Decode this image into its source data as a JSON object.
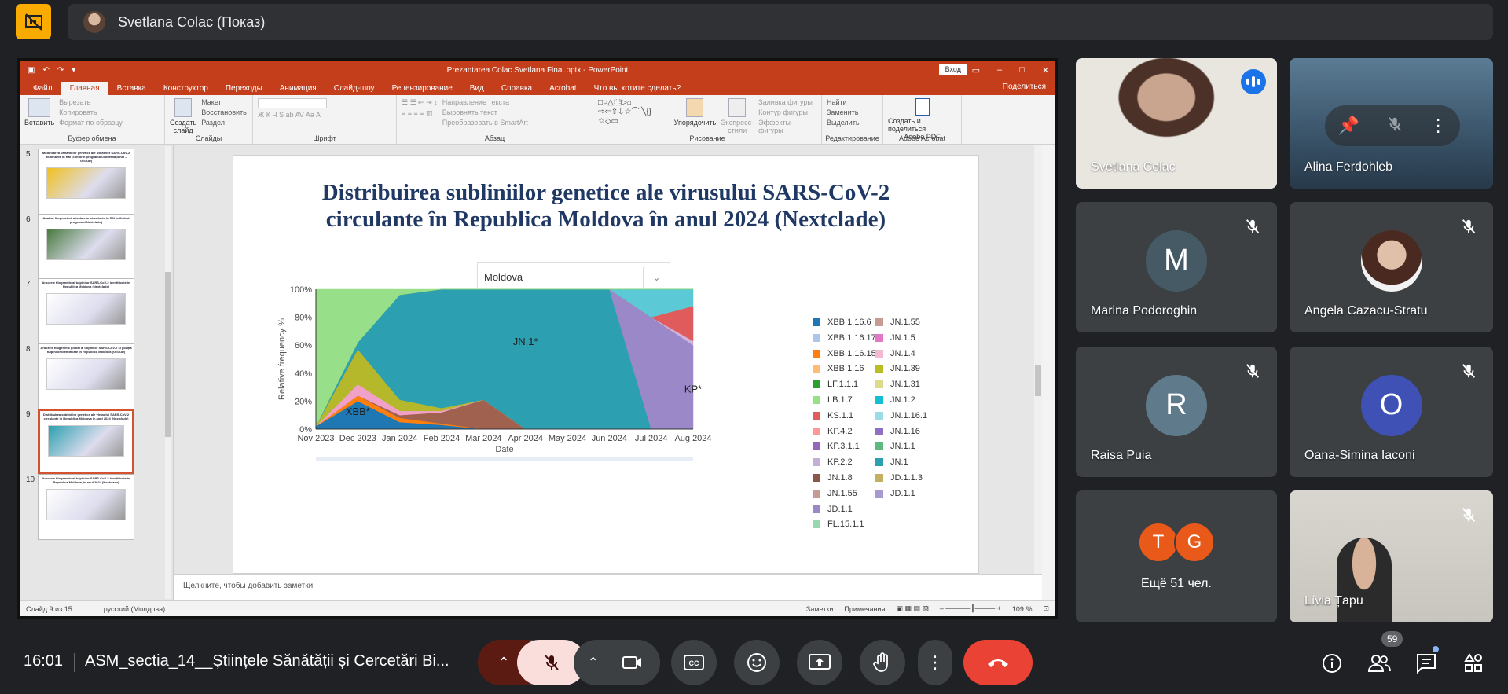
{
  "meet": {
    "presenter_label": "Svetlana Colac (Показ)",
    "clock": "16:01",
    "meeting_name": "ASM_sectia_14__Științele Sănătății și Cercetări Bi...",
    "participant_badge": "59",
    "colors": {
      "accent": "#8ab4f8",
      "end_call": "#ea4335",
      "mic_off": "#f9dedc",
      "logo": "#f9ab00"
    }
  },
  "participants": [
    {
      "name": "Svetlana Colac",
      "video": true,
      "speaking": true
    },
    {
      "name": "Alina Ferdohleb",
      "video": true,
      "muted": true
    },
    {
      "name": "Marina Podoroghin",
      "initial": "M",
      "color": "#455a64",
      "muted": true
    },
    {
      "name": "Angela Cazacu-Stratu",
      "photo": true,
      "muted": true
    },
    {
      "name": "Raisa Puia",
      "initial": "R",
      "color": "#5f7a8a",
      "muted": true
    },
    {
      "name": "Oana-Simina Iaconi",
      "initial": "O",
      "color": "#3f51b5",
      "muted": true
    },
    {
      "name": "Lívia Țapu",
      "video": true,
      "muted": true
    }
  ],
  "more_people": {
    "initials": [
      "T",
      "G"
    ],
    "label": "Ещё 51 чел."
  },
  "powerpoint": {
    "filename": "Prezantarea Colac Svetlana Final.pptx - PowerPoint",
    "login": "Вход",
    "share": "Поделиться",
    "tabs": [
      "Файл",
      "Главная",
      "Вставка",
      "Конструктор",
      "Переходы",
      "Анимация",
      "Слайд-шоу",
      "Рецензирование",
      "Вид",
      "Справка",
      "Acrobat",
      "Что вы хотите сделать?"
    ],
    "ribbon": {
      "paste": "Вставить",
      "cut": "Вырезать",
      "copy": "Копировать",
      "format_painter": "Формат по образцу",
      "clipboard": "Буфер обмена",
      "new_slide_1": "Создать",
      "new_slide_2": "слайд",
      "layout": "Макет",
      "reset": "Восстановить",
      "section": "Раздел",
      "slides": "Слайды",
      "font": "Шрифт",
      "text_direction": "Направление текста",
      "align_text": "Выровнять текст",
      "smartart": "Преобразовать в SmartArt",
      "paragraph": "Абзац",
      "arrange": "Упорядочить",
      "quick_styles_1": "Экспресс-",
      "quick_styles_2": "стили",
      "shape_fill": "Заливка фигуры",
      "shape_outline": "Контур фигуры",
      "shape_effects": "Эффекты фигуры",
      "drawing": "Рисование",
      "find": "Найти",
      "replace": "Заменить",
      "select": "Выделить",
      "editing": "Редактирование",
      "adobe_1": "Создать и поделиться",
      "adobe_2": "Adobe PDF",
      "adobe_acrobat": "Adobe Acrobat"
    },
    "thumbnails": [
      {
        "num": "5",
        "title": "Modificarea variantelor genetice ale izolatelor SARS-CoV-2 dominante în RM (conform programului internațional – GISAID)"
      },
      {
        "num": "6",
        "title": "Analiza filogenetică a izolatelor circulante în RM (utilizând programul Nextclade)"
      },
      {
        "num": "7",
        "title": "Arborele filogenetic al tulpinilor SARS-CoV-2 identificate în Republica Moldova (Nextclade)"
      },
      {
        "num": "8",
        "title": "Arborele filogenetic global al tulpinilor SARS-CoV-2 și poziția tulpinilor identificate în Republica Moldova (GISAID)"
      },
      {
        "num": "9",
        "title": "Distribuirea subliniilor genetice ale virusului SARS-CoV-2 circulante în Republica Moldova în anul 2024 (Nextclade)"
      },
      {
        "num": "10",
        "title": "Arborele filogenetic al tulpinilor SARS-CoV-2 identificate în Republica Moldova, în anul 2024 (Nextclade)"
      }
    ],
    "slide": {
      "title_line1": "Distribuirea subliniilor genetice ale virusului SARS-CoV-2",
      "title_line2": "circulante în Republica Moldova în anul 2024 (Nextclade)",
      "country": "Moldova"
    },
    "notes_placeholder": "Щелкните, чтобы добавить заметки",
    "status": {
      "slide": "Слайд 9 из 15",
      "language": "русский (Молдова)",
      "notes": "Заметки",
      "comments": "Примечания",
      "zoom": "109 %"
    }
  },
  "chart_data": {
    "type": "area",
    "stacked": true,
    "ylabel": "Relative frequency %",
    "xlabel": "Date",
    "x": [
      "Nov 2023",
      "Dec 2023",
      "Jan 2024",
      "Feb 2024",
      "Mar 2024",
      "Apr 2024",
      "May 2024",
      "Jun 2024",
      "Jul 2024",
      "Aug 2024"
    ],
    "yticks": [
      "0%",
      "20%",
      "40%",
      "60%",
      "80%",
      "100%"
    ],
    "ylim": [
      0,
      100
    ],
    "annotations": [
      {
        "text": "JN.1*",
        "x": "Apr 2024",
        "y": 60
      },
      {
        "text": "XBB*",
        "x": "Dec 2023",
        "y": 10
      },
      {
        "text": "KP*",
        "x": "Aug 2024",
        "y": 26
      }
    ],
    "series": [
      {
        "name": "XBB.1.16.6",
        "color": "#1f77b4",
        "values": [
          2,
          20,
          5,
          3,
          0,
          0,
          0,
          0,
          0,
          0
        ]
      },
      {
        "name": "XBB.1.16.15",
        "color": "#ff7f0e",
        "values": [
          0,
          4,
          3,
          1,
          0,
          0,
          0,
          0,
          0,
          0
        ]
      },
      {
        "name": "JN.1.55",
        "color": "#a0624e",
        "values": [
          0,
          0,
          2,
          8,
          21,
          0,
          0,
          0,
          0,
          0
        ]
      },
      {
        "name": "JN.1.4",
        "color": "#f1a1c7",
        "values": [
          0,
          8,
          3,
          1,
          0,
          0,
          0,
          0,
          0,
          0
        ]
      },
      {
        "name": "JN.1.39",
        "color": "#b5b82a",
        "values": [
          0,
          25,
          8,
          2,
          0,
          0,
          0,
          0,
          0,
          0
        ]
      },
      {
        "name": "JN.1",
        "color": "#2ca0b0",
        "values": [
          0,
          5,
          75,
          85,
          79,
          100,
          100,
          100,
          0,
          0
        ]
      },
      {
        "name": "JD.1.1",
        "color": "#9b88c9",
        "values": [
          0,
          0,
          0,
          0,
          0,
          0,
          0,
          0,
          80,
          60
        ]
      },
      {
        "name": "KP.2.2",
        "color": "#d0b3dc",
        "values": [
          0,
          0,
          0,
          0,
          0,
          0,
          0,
          0,
          0,
          3
        ]
      },
      {
        "name": "KS.1.1",
        "color": "#e05c5c",
        "values": [
          0,
          0,
          0,
          0,
          0,
          0,
          0,
          0,
          0,
          25
        ]
      },
      {
        "name": "JN.1.2",
        "color": "#5bc9d6",
        "values": [
          0,
          0,
          0,
          0,
          0,
          0,
          0,
          0,
          20,
          12
        ]
      },
      {
        "name": "LF.1.1.1",
        "color": "#2ca02c",
        "values": [
          0,
          0,
          0,
          0,
          0,
          0,
          0,
          0,
          0,
          0
        ]
      },
      {
        "name": "FL.15.1.1",
        "color": "#98df8a",
        "values": [
          98,
          38,
          4,
          0,
          0,
          0,
          0,
          0,
          0,
          0
        ]
      }
    ],
    "legend": {
      "col1": [
        {
          "name": "XBB.1.16.6",
          "color": "#1f77b4"
        },
        {
          "name": "XBB.1.16.17",
          "color": "#aec7e8"
        },
        {
          "name": "XBB.1.16.15",
          "color": "#ff7f0e"
        },
        {
          "name": "XBB.1.16",
          "color": "#ffbb78"
        },
        {
          "name": "LF.1.1.1",
          "color": "#2ca02c"
        },
        {
          "name": "LB.1.7",
          "color": "#98df8a"
        },
        {
          "name": "KS.1.1",
          "color": "#e05c5c"
        },
        {
          "name": "KP.4.2",
          "color": "#ff9896"
        },
        {
          "name": "KP.3.1.1",
          "color": "#9467bd"
        },
        {
          "name": "KP.2.2",
          "color": "#c5b0d5"
        },
        {
          "name": "JN.1.8",
          "color": "#8c564b"
        },
        {
          "name": "JN.1.55",
          "color": "#c49c94"
        },
        {
          "name": "JD.1.1",
          "color": "#9b88c9"
        },
        {
          "name": "FL.15.1.1",
          "color": "#98d8b0"
        }
      ],
      "col2": [
        {
          "name": "JN.1.55",
          "color": "#c49c94"
        },
        {
          "name": "JN.1.5",
          "color": "#e377c2"
        },
        {
          "name": "JN.1.4",
          "color": "#f7b6d2"
        },
        {
          "name": "JN.1.39",
          "color": "#bcbd22"
        },
        {
          "name": "JN.1.31",
          "color": "#dbdb8d"
        },
        {
          "name": "JN.1.2",
          "color": "#17becf"
        },
        {
          "name": "JN.1.16.1",
          "color": "#9edae5"
        },
        {
          "name": "JN.1.16",
          "color": "#8e6fc4"
        },
        {
          "name": "JN.1.1",
          "color": "#5fb87f"
        },
        {
          "name": "JN.1",
          "color": "#2ca0b0"
        },
        {
          "name": "JD.1.1.3",
          "color": "#c4b060"
        },
        {
          "name": "JD.1.1",
          "color": "#a898d0"
        }
      ]
    }
  }
}
